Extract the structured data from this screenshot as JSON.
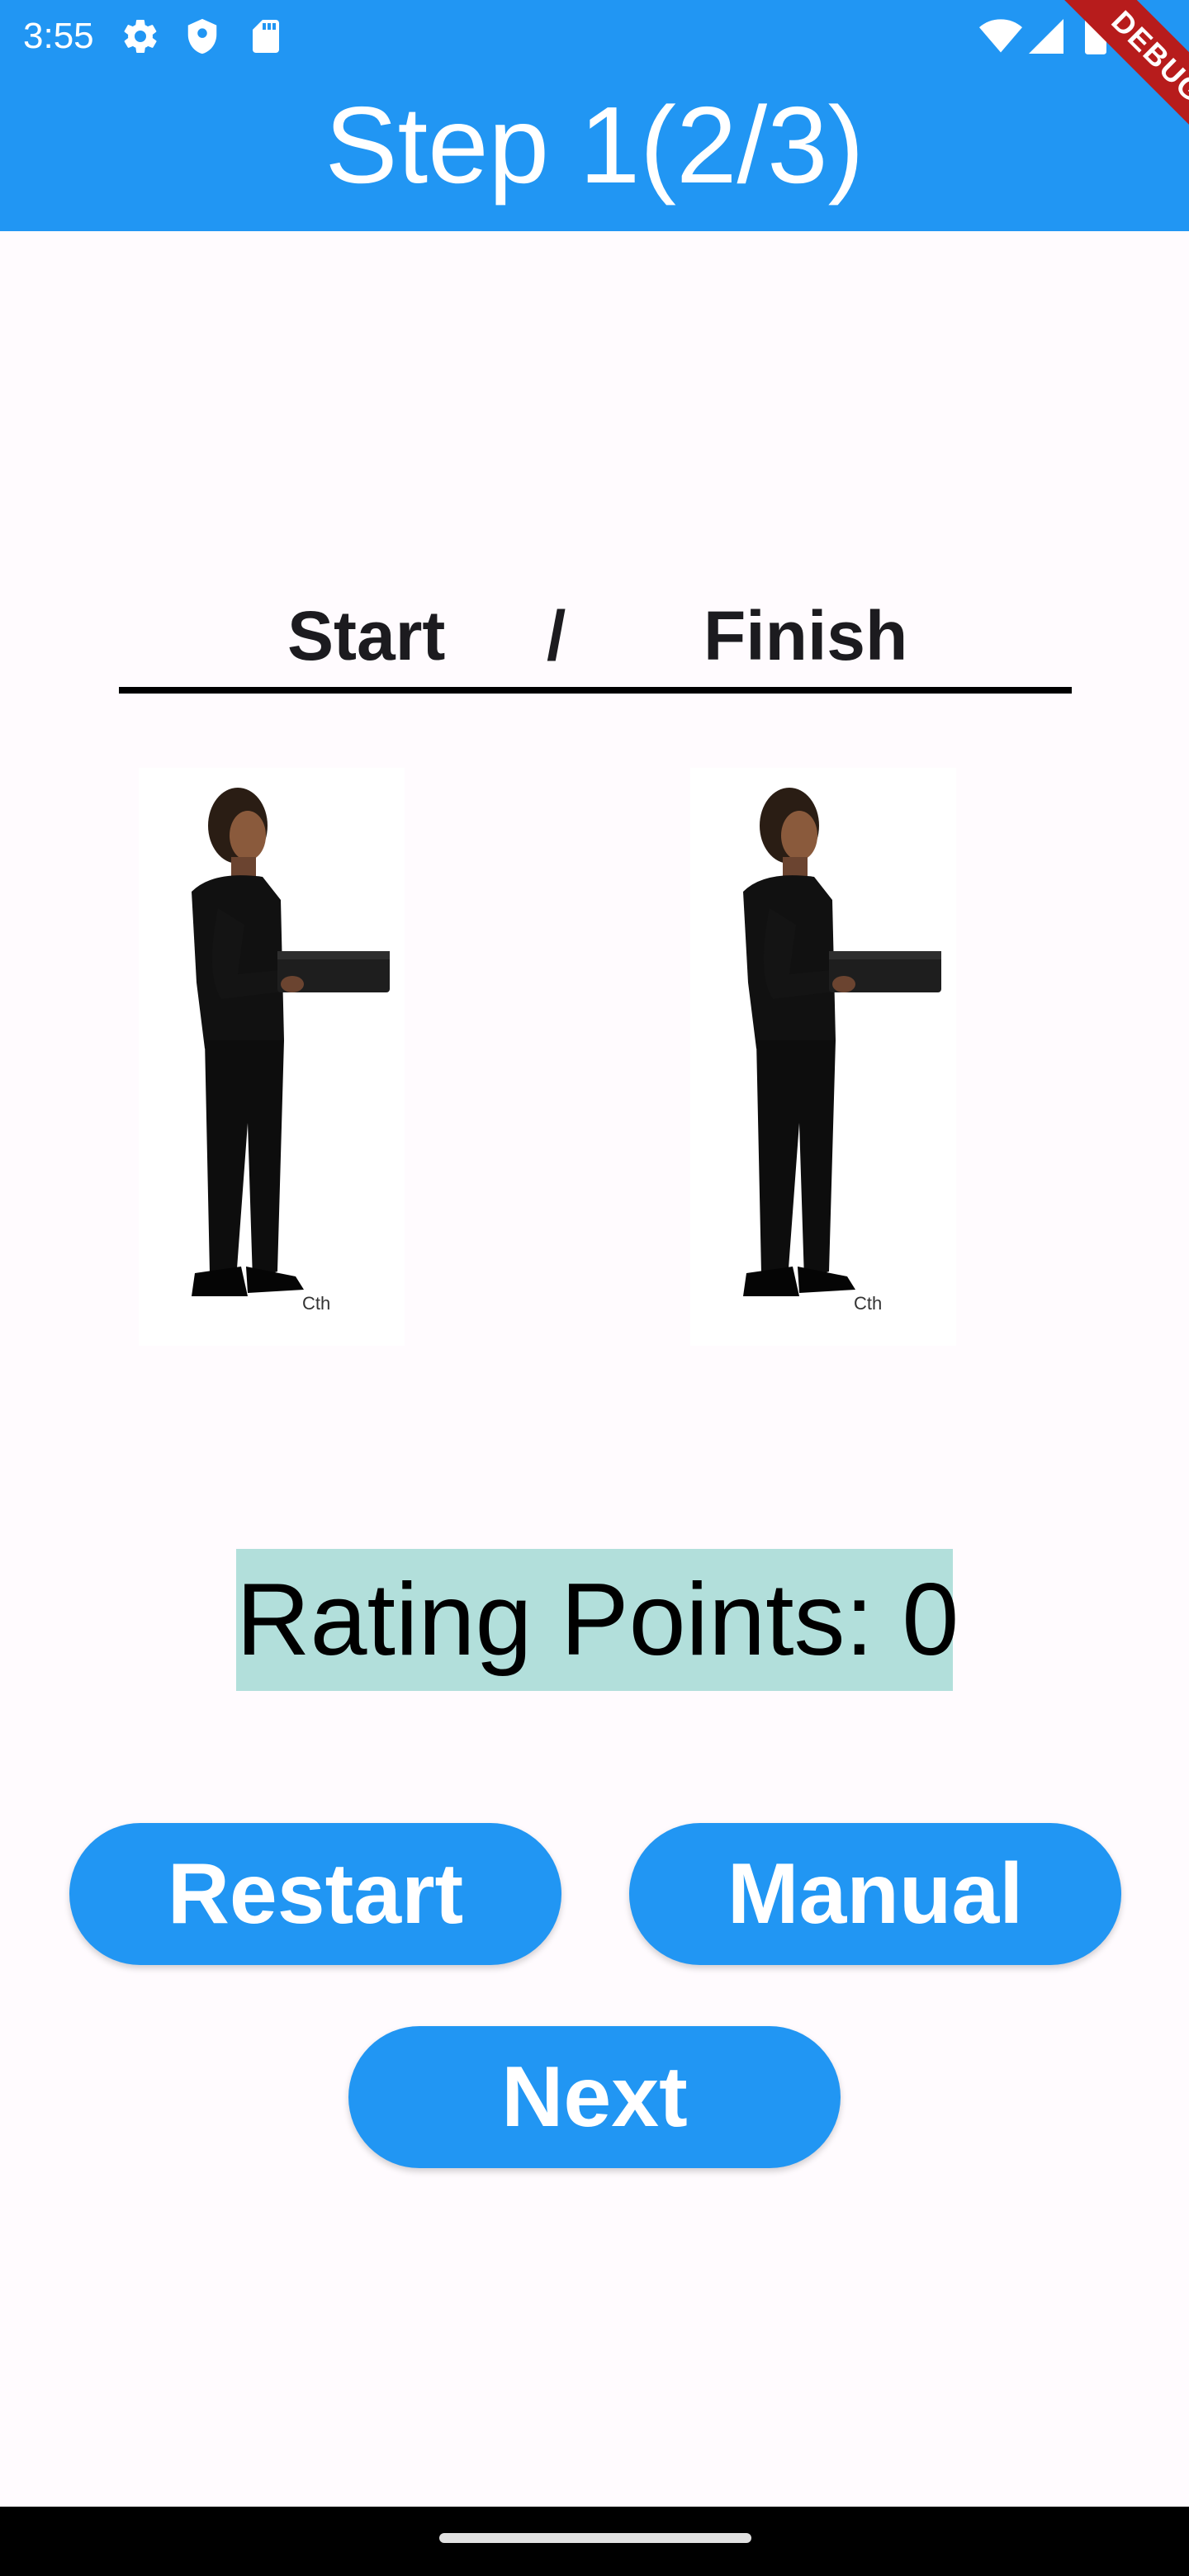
{
  "status_bar": {
    "time": "3:55",
    "icons": [
      "gear-icon",
      "shield-icon",
      "sd-card-icon",
      "wifi-icon",
      "signal-icon",
      "battery-icon",
      "notification-dot-icon"
    ]
  },
  "app_bar": {
    "title": "Step 1(2/3)",
    "color": "#2196f3",
    "debug_banner": "DEBUG"
  },
  "pose_labels": {
    "start": "Start",
    "separator": "/",
    "finish": "Finish"
  },
  "figures": [
    {
      "icon": "standing-person-holding-box-image",
      "caption": "Cth"
    },
    {
      "icon": "standing-person-holding-box-image",
      "caption": "Cth"
    }
  ],
  "rating": {
    "text": "Rating Points: 0",
    "background": "#b2dfdb"
  },
  "buttons": {
    "restart": "Restart",
    "manual": "Manual",
    "next": "Next"
  }
}
